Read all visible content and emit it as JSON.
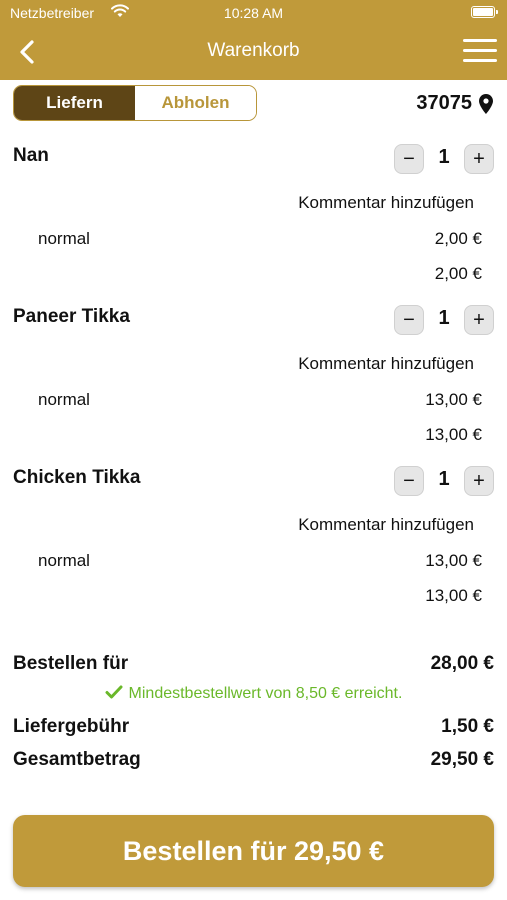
{
  "status_bar": {
    "carrier": "Netzbetreiber",
    "time": "10:28 AM"
  },
  "nav": {
    "title": "Warenkorb"
  },
  "segment": {
    "deliver": "Liefern",
    "pickup": "Abholen",
    "selected": "Liefern"
  },
  "postcode": "37075",
  "items": [
    {
      "name": "Nan",
      "quantity": "1",
      "comment": "Kommentar hinzufügen",
      "variant": "normal",
      "variant_price": "2,00 €",
      "item_total": "2,00 €"
    },
    {
      "name": "Paneer Tikka",
      "quantity": "1",
      "comment": "Kommentar hinzufügen",
      "variant": "normal",
      "variant_price": "13,00 €",
      "item_total": "13,00 €"
    },
    {
      "name": "Chicken Tikka",
      "quantity": "1",
      "comment": "Kommentar hinzufügen",
      "variant": "normal",
      "variant_price": "13,00 €",
      "item_total": "13,00 €"
    }
  ],
  "summary": {
    "subtotal_label": "Bestellen für",
    "subtotal_value": "28,00 €",
    "minimum_note": "Mindestbestellwert von 8,50 € erreicht.",
    "delivery_fee_label": "Liefergebühr",
    "delivery_fee_value": "1,50 €",
    "total_label": "Gesamtbetrag",
    "total_value": "29,50 €"
  },
  "order_button": "Bestellen für 29,50 €",
  "colors": {
    "brand_gold": "#c09a3a",
    "segment_active": "#5e4516",
    "success_green": "#6ab82a"
  }
}
